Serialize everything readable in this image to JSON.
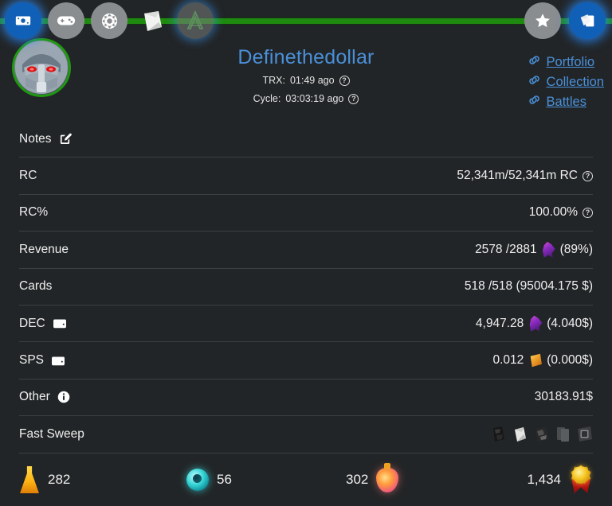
{
  "nav": {
    "left_items": [
      {
        "name": "money-icon",
        "label": "Market",
        "style": "blue"
      },
      {
        "name": "gamepad-icon",
        "label": "Play",
        "style": "gray"
      },
      {
        "name": "gear-icon",
        "label": "Settings",
        "style": "gray"
      },
      {
        "name": "pack-icon",
        "label": "Packs",
        "style": "clear"
      },
      {
        "name": "anvil-logo-icon",
        "label": "Anvil",
        "style": "ghost"
      }
    ],
    "right_items": [
      {
        "name": "star-icon",
        "label": "Favorites",
        "style": "gray"
      },
      {
        "name": "cards-icon",
        "label": "Cards",
        "style": "blue"
      }
    ]
  },
  "header": {
    "username": "Definethedollar",
    "avatar_name": "robot-mech-avatar",
    "trx_label": "TRX:",
    "trx_value": "01:49 ago",
    "cycle_label": "Cycle:",
    "cycle_value": "03:03:19 ago",
    "help_glyph": "?",
    "links": [
      {
        "label": "Portfolio",
        "icon": "link-icon"
      },
      {
        "label": "Collection",
        "icon": "link-icon"
      },
      {
        "label": "Battles",
        "icon": "link-icon"
      }
    ]
  },
  "rows": [
    {
      "id": "notes",
      "label": "Notes",
      "label_icon": "edit-pencil-icon",
      "value": "",
      "value_icon": "",
      "suffix": ""
    },
    {
      "id": "rc",
      "label": "RC",
      "label_icon": "",
      "value": "52,341m/52,341m RC",
      "value_icon": "help-icon",
      "suffix": ""
    },
    {
      "id": "rc-percent",
      "label": "RC%",
      "label_icon": "",
      "value": "100.00%",
      "value_icon": "help-icon",
      "suffix": ""
    },
    {
      "id": "revenue",
      "label": "Revenue",
      "label_icon": "",
      "value": "2578 /2881",
      "value_icon": "dec-token-icon",
      "suffix": "(89%)"
    },
    {
      "id": "cards",
      "label": "Cards",
      "label_icon": "",
      "value": "518 /518 (95004.175 $)",
      "value_icon": "",
      "suffix": ""
    },
    {
      "id": "dec",
      "label": "DEC",
      "label_icon": "wallet-icon",
      "value": "4,947.28",
      "value_icon": "dec-token-icon",
      "suffix": "(4.040$)"
    },
    {
      "id": "sps",
      "label": "SPS",
      "label_icon": "wallet-icon",
      "value": "0.012",
      "value_icon": "sps-token-icon",
      "suffix": "(0.000$)"
    },
    {
      "id": "other",
      "label": "Other",
      "label_icon": "info-icon",
      "value": "30183.91$",
      "value_icon": "",
      "suffix": ""
    },
    {
      "id": "fast-sweep",
      "label": "Fast Sweep",
      "label_icon": "",
      "value": "",
      "value_icon": "pack-icons",
      "suffix": ""
    }
  ],
  "fast_sweep_packs": [
    {
      "name": "pack-chaos-legion-icon"
    },
    {
      "name": "pack-white-envelope-icon"
    },
    {
      "name": "pack-rift-watchers-icon"
    },
    {
      "name": "pack-plain-card-icon"
    },
    {
      "name": "pack-framed-card-icon"
    }
  ],
  "bottom_stats": [
    {
      "id": "legendary-potion",
      "icon": "gold-potion-icon",
      "value": "282",
      "order": "icon-first"
    },
    {
      "id": "energy-orb",
      "icon": "teal-orb-icon",
      "value": "56",
      "order": "icon-first"
    },
    {
      "id": "alchemy-potion",
      "icon": "pink-potion-icon",
      "value": "302",
      "order": "value-first"
    },
    {
      "id": "rank-medal",
      "icon": "gold-medal-icon",
      "value": "1,434",
      "order": "value-first"
    }
  ],
  "colors": {
    "background": "#222527",
    "accent_blue": "#4a90d9",
    "green_bar": "#1f8a10",
    "divider": "#3c4042",
    "text": "#efefef",
    "dec_purple": "#a93bd0",
    "sps_gold": "#f0a32b",
    "avatar_ring": "#1f9a10"
  }
}
